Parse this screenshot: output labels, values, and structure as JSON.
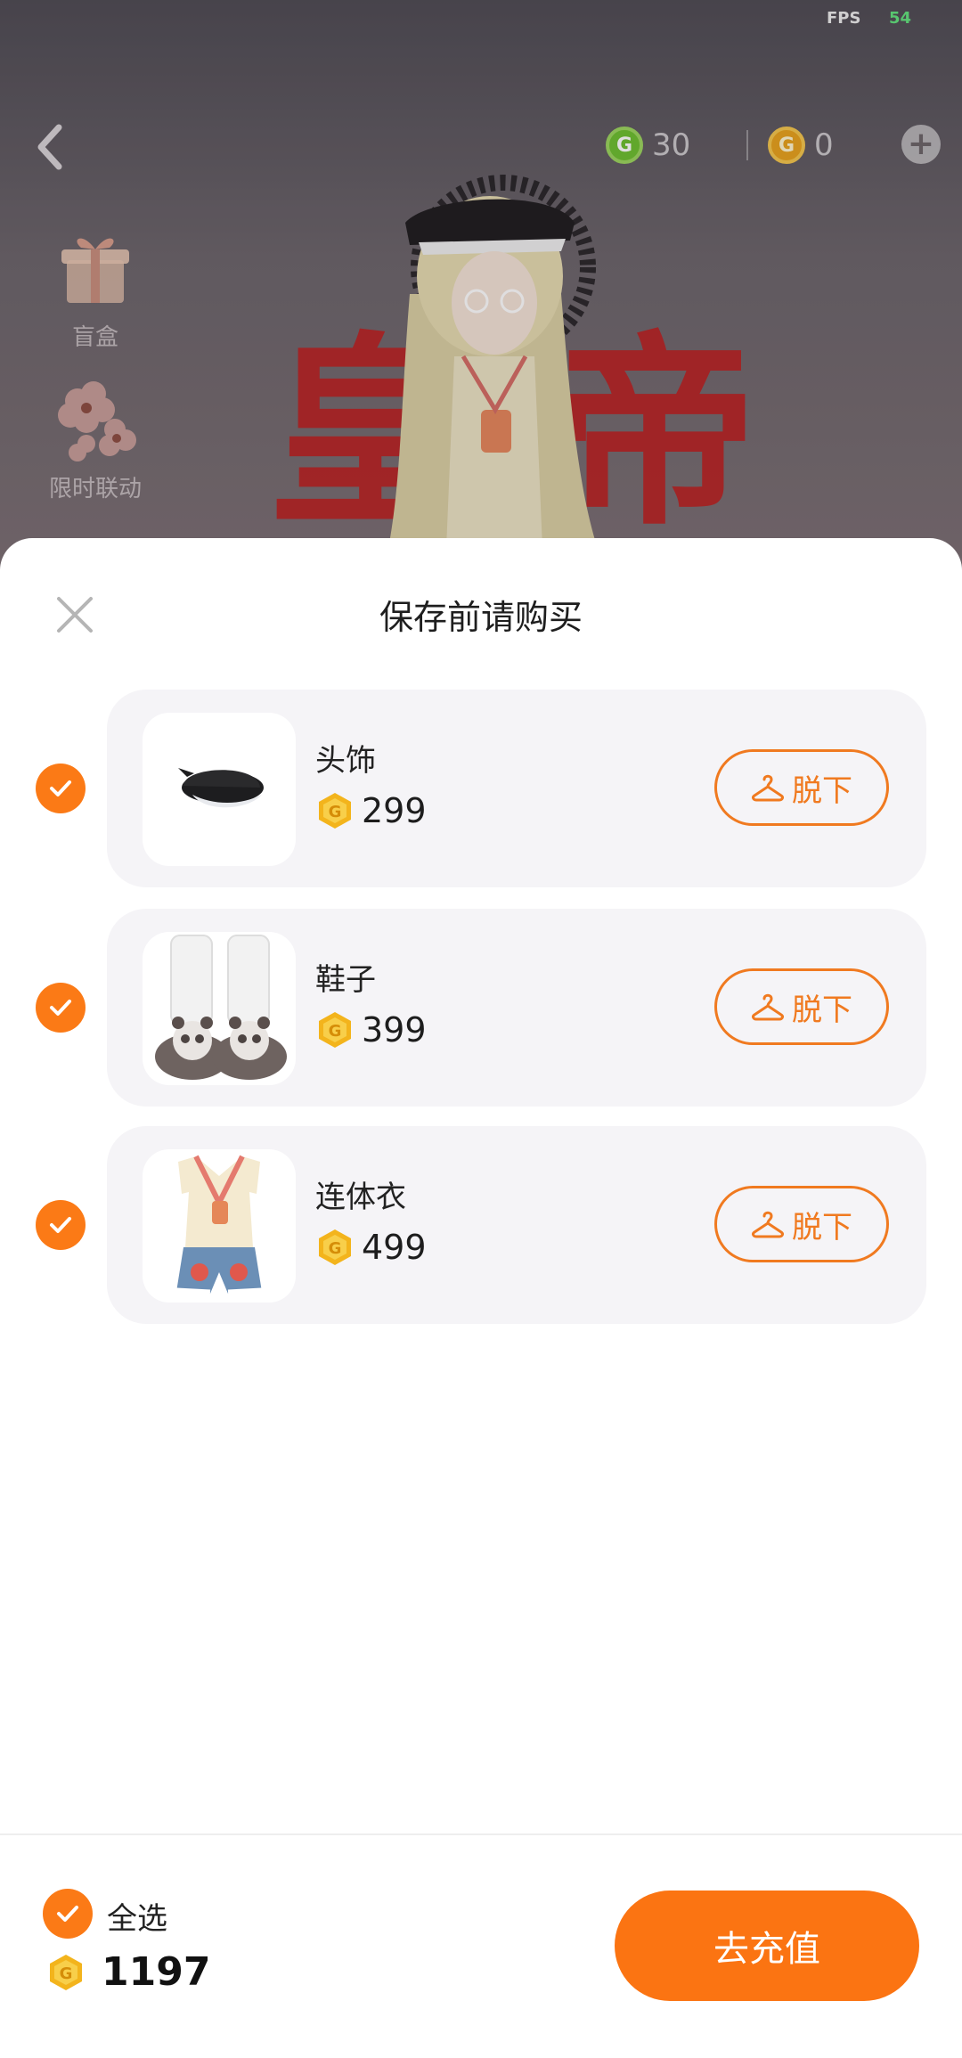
{
  "status": {
    "fps_label": "FPS",
    "fps_value": "54"
  },
  "topbar": {
    "back_icon": "chevron-left-icon",
    "green_currency": {
      "icon": "g-coin-green-icon",
      "value": "30"
    },
    "gold_currency": {
      "icon": "g-coin-gold-icon",
      "value": "0"
    },
    "add_icon": "plus-icon"
  },
  "side_menu": [
    {
      "label": "盲盒",
      "icon": "gift-box-icon"
    },
    {
      "label": "限时联动",
      "icon": "flower-icon"
    }
  ],
  "scene_text": {
    "left_char": "皇",
    "right_char": "帝"
  },
  "sheet": {
    "title": "保存前请购买",
    "close_icon": "close-icon",
    "items": [
      {
        "name": "头饰",
        "price": "299",
        "remove_label": "脱下",
        "checked": true,
        "thumb_icon": "beret-hat-icon"
      },
      {
        "name": "鞋子",
        "price": "399",
        "remove_label": "脱下",
        "checked": true,
        "thumb_icon": "panda-slippers-icon"
      },
      {
        "name": "连体衣",
        "price": "499",
        "remove_label": "脱下",
        "checked": true,
        "thumb_icon": "outfit-icon"
      }
    ],
    "footer": {
      "select_all_label": "全选",
      "total": "1197",
      "recharge_label": "去充值"
    }
  },
  "colors": {
    "accent": "#fb7a16",
    "coin": "#f2b21a",
    "card_bg": "#f5f4f7"
  }
}
